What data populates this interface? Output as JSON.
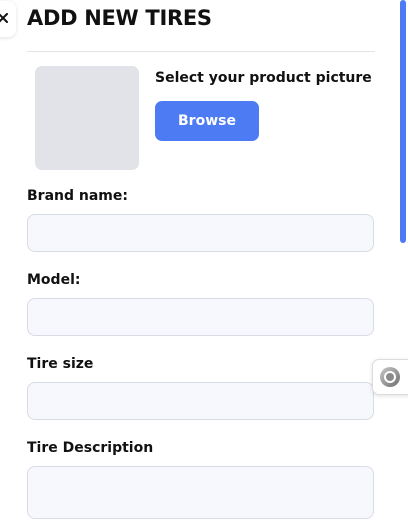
{
  "header": {
    "title": "ADD NEW TIRES"
  },
  "picture": {
    "label": "Select your product picture",
    "browse_label": "Browse"
  },
  "form": {
    "brand_label": "Brand name:",
    "brand_value": "",
    "model_label": "Model:",
    "model_value": "",
    "size_label": "Tire size",
    "size_value": "",
    "description_label": "Tire Description",
    "description_value": ""
  },
  "icons": {
    "close": "close-icon",
    "widget": "widget-icon"
  },
  "colors": {
    "accent": "#4d7bf3",
    "placeholder_bg": "#e2e3e9",
    "input_bg": "#f6f8fd"
  }
}
